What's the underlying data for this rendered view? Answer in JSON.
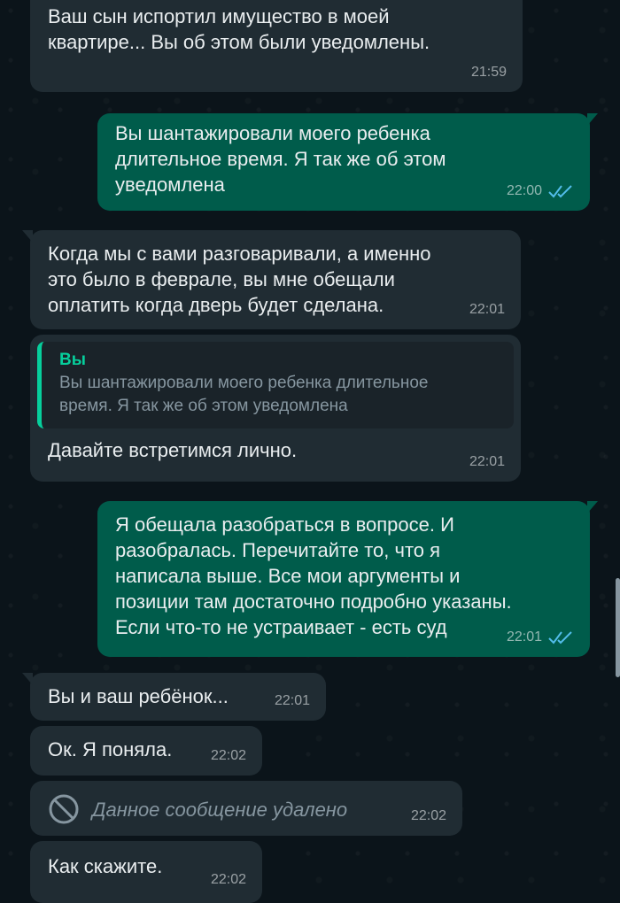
{
  "messages": [
    {
      "text": "Ваш сын испортил имущество в моей\nквартире... Вы об этом были уведомлены.",
      "time": "21:59"
    },
    {
      "text": "Вы шантажировали моего ребенка\nдлительное время. Я  так же об этом\nуведомлена",
      "time": "22:00"
    },
    {
      "text": "Когда мы с вами разговаривали, а именно\nэто было в феврале, вы мне обещали\nоплатить когда дверь будет сделана.",
      "time": "22:01"
    },
    {
      "quote_author": "Вы",
      "quote_text": "Вы шантажировали моего ребенка длительное\nвремя. Я  так же об этом уведомлена",
      "text": "Давайте встретимся лично.",
      "time": "22:01"
    },
    {
      "text": "Я обещала разобраться в вопросе. И\nразобралась. Перечитайте то, что я\nнаписала выше. Все мои аргументы и\nпозиции там достаточно подробно указаны.\nЕсли что-то не устраивает - есть суд",
      "time": "22:01"
    },
    {
      "text": "Вы и ваш ребёнок...",
      "time": "22:01"
    },
    {
      "text": "Ок. Я поняла.",
      "time": "22:02"
    },
    {
      "text": "Данное сообщение удалено",
      "time": "22:02",
      "icon": "blocked-icon"
    },
    {
      "text": "Как скажите.",
      "time": "22:02"
    }
  ],
  "colors": {
    "background": "#0b141a",
    "incoming_bubble": "#202c33",
    "outgoing_bubble": "#005c4b",
    "read_ticks": "#53bdeb",
    "quote_accent": "#06cf9c"
  }
}
